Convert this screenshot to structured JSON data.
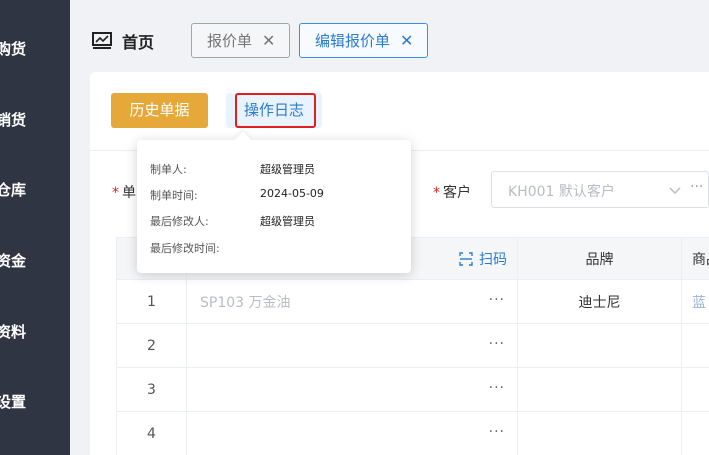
{
  "sidebar": {
    "items": [
      {
        "label": "购货"
      },
      {
        "label": "销货"
      },
      {
        "label": "仓库"
      },
      {
        "label": "资金"
      },
      {
        "label": "资料"
      },
      {
        "label": "设置"
      }
    ]
  },
  "header": {
    "home_label": "首页",
    "tabs": [
      {
        "label": "报价单",
        "close": "✕"
      },
      {
        "label": "编辑报价单",
        "close": "✕"
      }
    ]
  },
  "toolbar": {
    "history_label": "历史单据",
    "log_label": "操作日志"
  },
  "form": {
    "doc_label": "单",
    "customer_label": "客户",
    "customer_value": "KH001 默认客户",
    "customer_more": "···",
    "required_mark": "*"
  },
  "table": {
    "scan_label": "扫码",
    "columns": [
      "",
      "",
      "品牌",
      "商品"
    ],
    "more_dots": "···",
    "rows": [
      {
        "index": "1",
        "product": "SP103 万金油",
        "brand": "迪士尼",
        "more": "蓝"
      },
      {
        "index": "2",
        "product": "",
        "brand": "",
        "more": ""
      },
      {
        "index": "3",
        "product": "",
        "brand": "",
        "more": ""
      },
      {
        "index": "4",
        "product": "",
        "brand": "",
        "more": ""
      }
    ]
  },
  "popover": {
    "rows": [
      {
        "key": "制单人:",
        "value": "超级管理员"
      },
      {
        "key": "制单时间:",
        "value": "2024-05-09"
      },
      {
        "key": "最后修改人:",
        "value": "超级管理员"
      },
      {
        "key": "最后修改时间:",
        "value": ""
      }
    ]
  },
  "colors": {
    "sidebar_bg": "#2f3542",
    "history_button": "#e7a83a",
    "accent_blue": "#2b7bd1",
    "highlight_red": "#e02020"
  }
}
